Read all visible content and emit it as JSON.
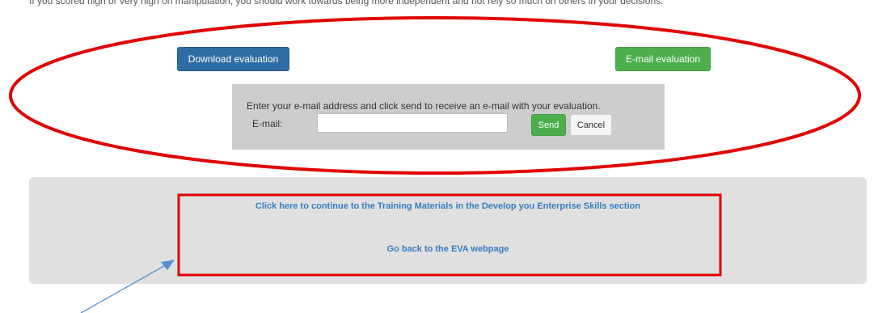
{
  "page": {
    "intro_text": "If you scored high or very high on manipulation, you should work towards being more independent and not rely so much on others in your decisions."
  },
  "actions": {
    "download_label": "Download evaluation",
    "email_label": "E-mail evaluation"
  },
  "email_form": {
    "instructions": "Enter your e-mail address and click send to receive an e-mail with your evaluation.",
    "field_label": "E-mail:",
    "field_value": "",
    "send_label": "Send",
    "cancel_label": "Cancel"
  },
  "navigation": {
    "training_link": "Click here to continue to the Training Materials in the Develop you Enterprise Skills section",
    "back_link": "Go back to the EVA webpage"
  },
  "annotations": {
    "ellipse_color": "#e00000",
    "box_color": "#e00000",
    "arrow_color": "#5a8fd0"
  },
  "colors": {
    "primary": "#2e6da4",
    "success": "#4cae4c",
    "link": "#3b7bbf"
  }
}
